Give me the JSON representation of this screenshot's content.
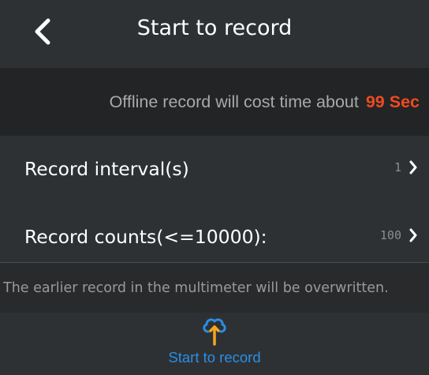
{
  "header": {
    "title": "Start to record",
    "back_icon": "chevron-left-icon"
  },
  "notice": {
    "text": "Offline record will cost time about",
    "value": "99 Sec",
    "value_color": "#f04a1f"
  },
  "settings": {
    "interval": {
      "label": "Record interval(s)",
      "value": "1",
      "icon": "chevron-right-icon"
    },
    "counts": {
      "label": "Record counts(<=10000):",
      "value": "100",
      "icon": "chevron-right-icon"
    }
  },
  "warning": {
    "text": "The earlier record in the multimeter will be overwritten."
  },
  "footer": {
    "button_label": "Start to record",
    "icon": "cloud-upload-icon",
    "accent_color": "#2b8ee8",
    "arrow_color": "#f5a623"
  }
}
